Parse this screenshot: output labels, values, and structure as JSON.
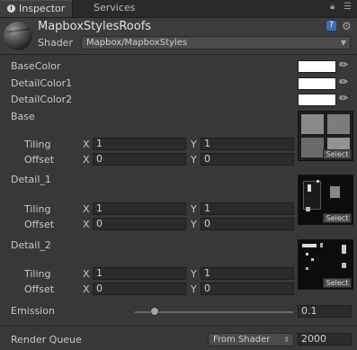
{
  "tabs": [
    {
      "label": "Inspector"
    },
    {
      "label": "Services"
    }
  ],
  "header": {
    "title": "MapboxStylesRoofs",
    "shader_label": "Shader",
    "shader_value": "Mapbox/MapboxStyles"
  },
  "colors": [
    {
      "label": "BaseColor",
      "value": "#FFFFFF"
    },
    {
      "label": "DetailColor1",
      "value": "#FFFFFF"
    },
    {
      "label": "DetailColor2",
      "value": "#FFFFFF"
    }
  ],
  "textures": [
    {
      "label": "Base",
      "tiling_label": "Tiling",
      "offset_label": "Offset",
      "tiling_x": "1",
      "tiling_y": "1",
      "offset_x": "0",
      "offset_y": "0",
      "select": "Select"
    },
    {
      "label": "Detail_1",
      "tiling_label": "Tiling",
      "offset_label": "Offset",
      "tiling_x": "1",
      "tiling_y": "1",
      "offset_x": "0",
      "offset_y": "0",
      "select": "Select"
    },
    {
      "label": "Detail_2",
      "tiling_label": "Tiling",
      "offset_label": "Offset",
      "tiling_x": "1",
      "tiling_y": "1",
      "offset_x": "0",
      "offset_y": "0",
      "select": "Select"
    }
  ],
  "axis": {
    "x": "X",
    "y": "Y"
  },
  "emission": {
    "label": "Emission",
    "value": "0.1",
    "level": 0.1
  },
  "render_queue": {
    "label": "Render Queue",
    "mode": "From Shader",
    "value": "2000"
  }
}
